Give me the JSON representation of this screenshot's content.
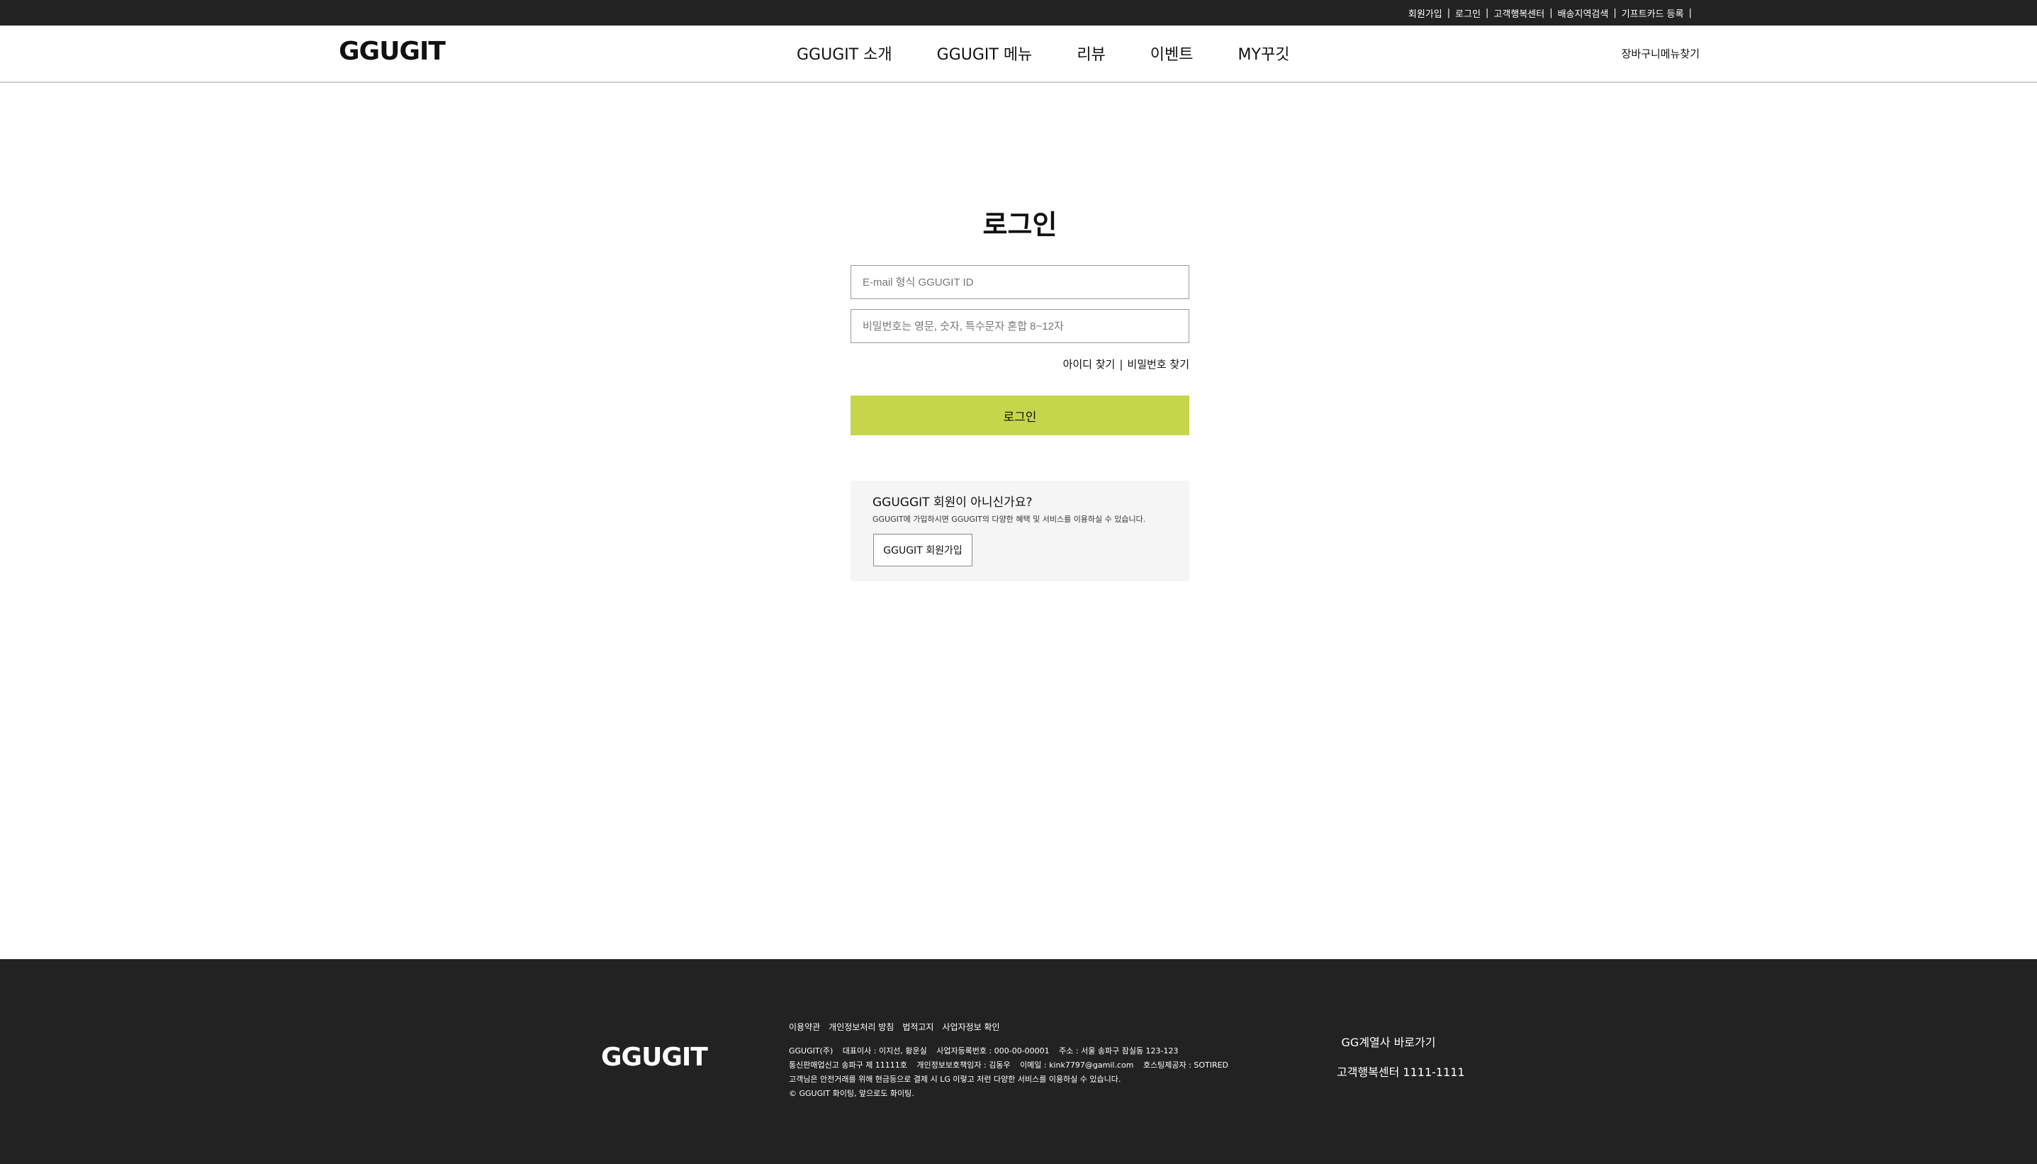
{
  "utility_bar": {
    "links": [
      "회원가입",
      "로그인",
      "고객행복센터",
      "배송지역검색",
      "기프트카드 등록"
    ],
    "separator": "|"
  },
  "header": {
    "logo": "GGUGIT",
    "nav": [
      "GGUGIT 소개",
      "GGUGIT 메뉴",
      "리뷰",
      "이벤트",
      "MY꾸깃"
    ],
    "util_cart": "장바구니",
    "util_find_menu": "메뉴찾기"
  },
  "login": {
    "title": "로그인",
    "email_placeholder": "E-mail 형식 GGUGIT ID",
    "password_placeholder": "비밀번호는 영문, 숫자, 특수문자 혼합 8~12자",
    "find_id": "아이디 찾기",
    "find_separator": "|",
    "find_password": "비밀번호 찾기",
    "button_label": "로그인",
    "button_color": "#c5d64b"
  },
  "signup": {
    "title": "GGUGGIT 회원이 아니신가요?",
    "description": "GGUGIT에 가입하시면 GGUGIT의 다양한 혜택 및 서비스를 이용하실 수 있습니다.",
    "button_label": "GGUGIT 회원가입"
  },
  "footer": {
    "logo": "GGUGIT",
    "links": [
      "이용약관",
      "개인정보처리 방침",
      "법적고지",
      "사업자정보 확인"
    ],
    "info": {
      "company": "GGUGIT(주)",
      "ceo": "대표이사 : 이지선, 황운실",
      "business_number": "사업자등록번호 : 000-00-00001",
      "address": "주소 : 서울 송파구 잠실동 123-123",
      "mail_order": "통신판매업신고 송파구 제 11111호",
      "privacy_officer": "개인정보보호책임자 : 김동우",
      "email": "이메일 : kink7797@gamil.com",
      "hosting": "호스팅제공자 : SOTIRED",
      "safety_notice": "고객님은 안전거래를 위해 현금등으로 결제 시 LG 이렇고 저런 다양한 서비스를 이용하실 수 있습니다.",
      "copyright": "© GGUGIT 화이팅, 앞으로도 화이팅."
    },
    "affiliates": "GG계열사 바로가기",
    "customer_center": "고객행복센터 1111-1111"
  },
  "colors": {
    "top_bar": "#222222",
    "footer": "#222222",
    "accent": "#c5d64b",
    "signup_box": "#f5f5f5"
  }
}
